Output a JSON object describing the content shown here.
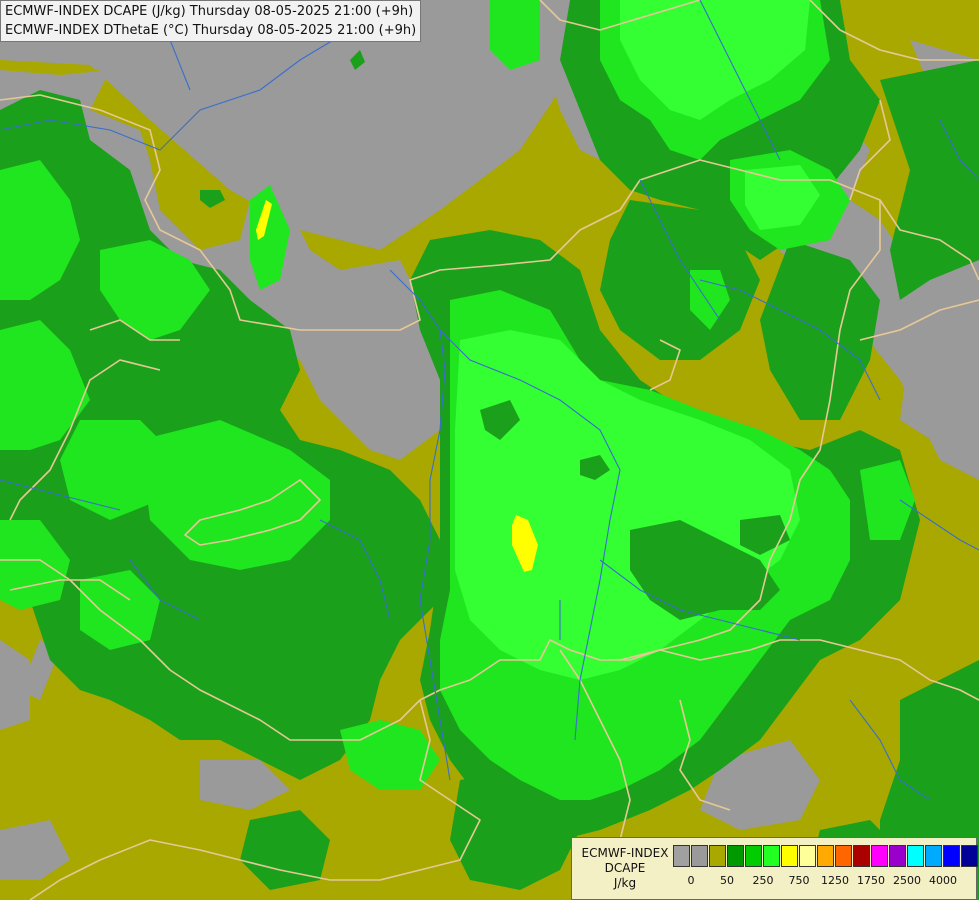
{
  "titles": {
    "line1": "ECMWF-INDEX DCAPE (J/kg) Thursday 08-05-2025 21:00 (+9h)",
    "line2": "ECMWF-INDEX DThetaE (°C) Thursday 08-05-2025 21:00 (+9h)"
  },
  "legend": {
    "name": "ECMWF-INDEX",
    "variable": "DCAPE",
    "unit": "J/kg",
    "colors": [
      "#a0a0a0",
      "#9a9a9a",
      "#a8a800",
      "#009900",
      "#00cc00",
      "#22ff22",
      "#ffff00",
      "#ffff99",
      "#ffaa00",
      "#ff6600",
      "#aa0000",
      "#ff00ff",
      "#9900cc",
      "#00ffff",
      "#00aaff",
      "#0000ff",
      "#000099"
    ],
    "tick_labels": [
      "0",
      "50",
      "250",
      "750",
      "1250",
      "1750",
      "2500",
      "4000"
    ]
  },
  "map_colors": {
    "gray": "#9a9a9a",
    "olive": "#a8a800",
    "dark_green": "#1aa01a",
    "green": "#1fe61f",
    "bright_green": "#33ff33",
    "yellow": "#ffff00",
    "border": "#e6c896",
    "river": "#3a6ecc"
  }
}
